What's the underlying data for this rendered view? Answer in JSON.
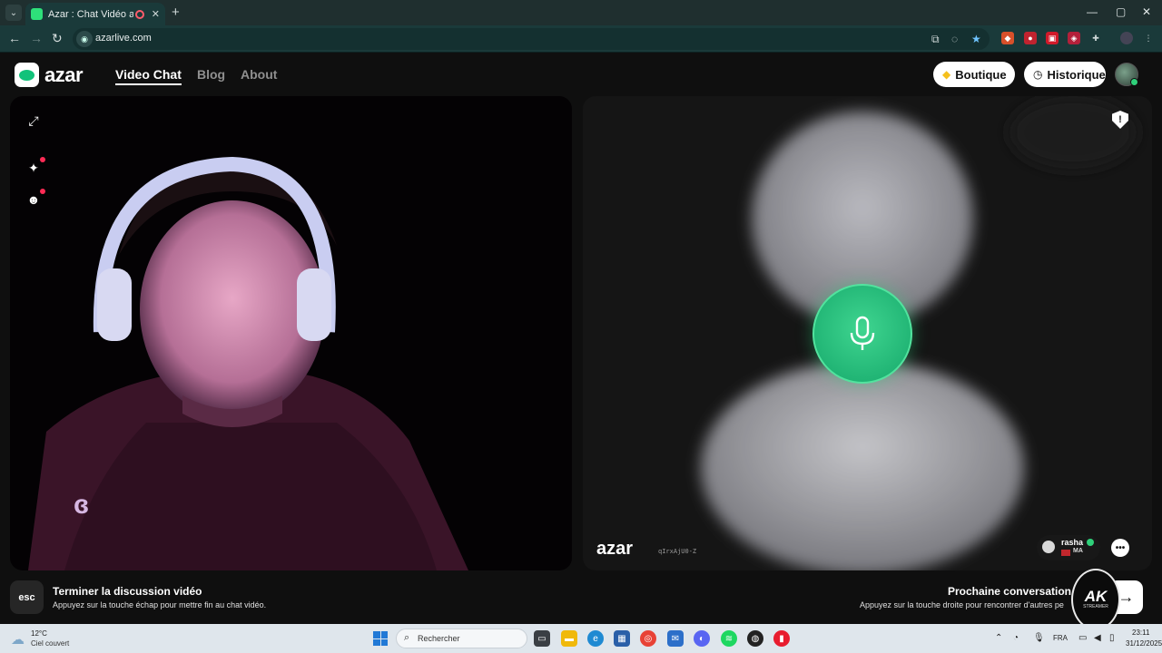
{
  "browser": {
    "tab_title": "Azar : Chat Vidéo avec de n",
    "tab_close": "✕",
    "new_tab": "+",
    "window_controls": {
      "minimize": "—",
      "maximize": "▢",
      "close": "✕"
    },
    "url": "azarlive.com"
  },
  "app": {
    "logo_text": "azar",
    "nav": {
      "video_chat": "Video Chat",
      "blog": "Blog",
      "about": "About"
    },
    "boutique_label": "Boutique",
    "historique_label": "Historique",
    "accent_color": "#1ec47c"
  },
  "remote": {
    "logo_text": "azar",
    "id_text": "qIrxAjU0-Z",
    "peer_name": "rasha",
    "peer_country": "MA"
  },
  "footer": {
    "esc_key": "esc",
    "end_title": "Terminer la discussion vidéo",
    "end_sub": "Appuyez sur la touche échap pour mettre fin au chat vidéo.",
    "next_title": "Prochaine conversation",
    "next_sub": "Appuyez sur la touche droite pour rencontrer d'autres pe",
    "next_key": "→"
  },
  "overlay": {
    "stream_logo_main": "AK",
    "stream_logo_sub": "STREAMER"
  },
  "taskbar": {
    "weather_temp": "12°C",
    "weather_desc": "Ciel couvert",
    "search_placeholder": "Rechercher",
    "language": "FRA",
    "time": "23:11",
    "date": "31/12/2025"
  }
}
